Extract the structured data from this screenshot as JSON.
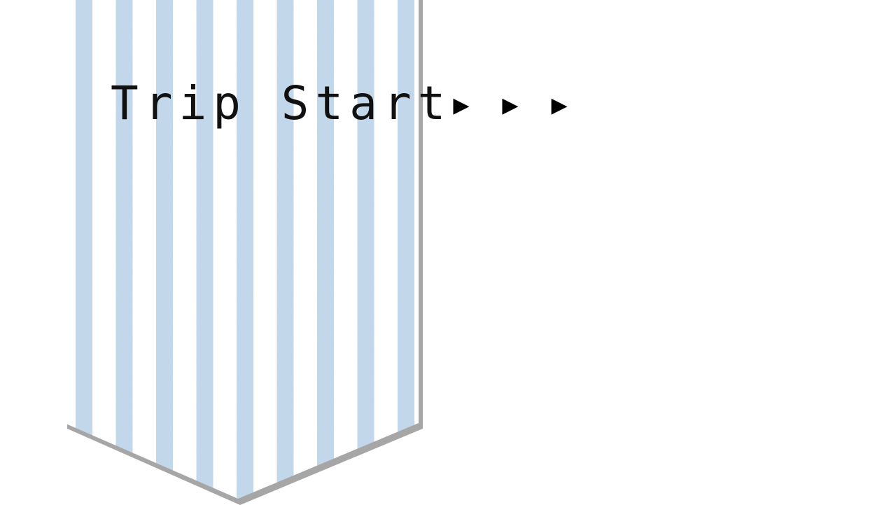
{
  "title": "Trip Start",
  "arrows": "▶▶▶",
  "banner": {
    "stripe_color": "#bcd3e8",
    "background_color": "#ffffff",
    "shadow_color": "#a6a6a6"
  }
}
